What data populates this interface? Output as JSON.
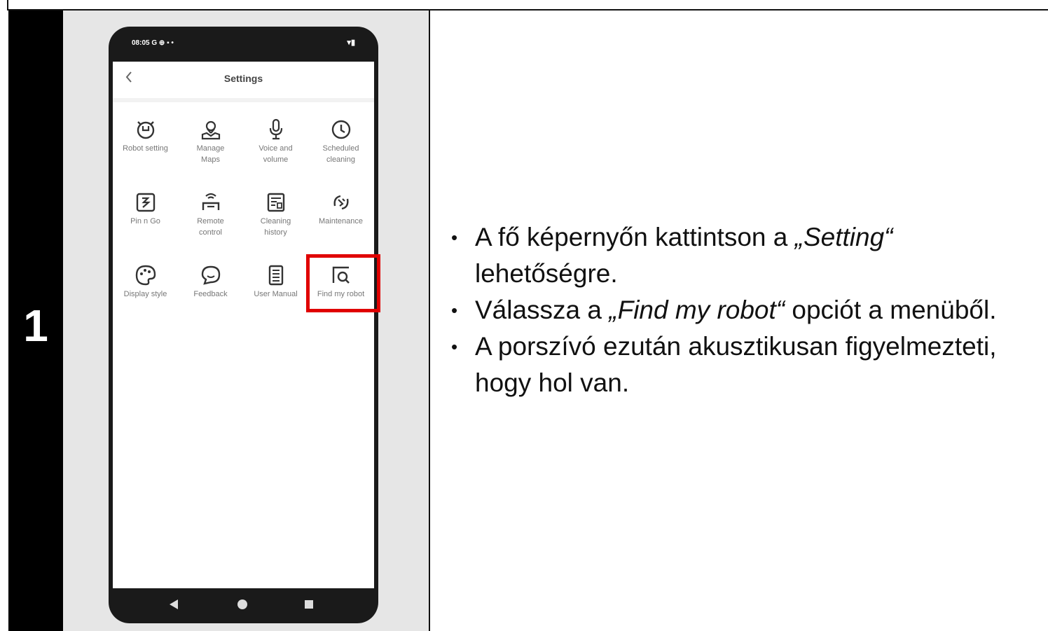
{
  "step": {
    "number": "1"
  },
  "phone": {
    "status_time": "08:05",
    "status_icons_left": "G ⊕ ▪ •",
    "status_icons_right": "▾▮",
    "screen_title": "Settings",
    "settings_items": [
      {
        "label_line1": "Robot setting",
        "label_line2": "",
        "icon": "robot-icon"
      },
      {
        "label_line1": "Manage",
        "label_line2": "Maps",
        "icon": "map-icon"
      },
      {
        "label_line1": "Voice and",
        "label_line2": "volume",
        "icon": "microphone-icon"
      },
      {
        "label_line1": "Scheduled",
        "label_line2": "cleaning",
        "icon": "clock-icon"
      },
      {
        "label_line1": "Pin n Go",
        "label_line2": "",
        "icon": "pin-n-go-icon"
      },
      {
        "label_line1": "Remote",
        "label_line2": "control",
        "icon": "remote-control-icon"
      },
      {
        "label_line1": "Cleaning",
        "label_line2": "history",
        "icon": "history-icon"
      },
      {
        "label_line1": "Maintenance",
        "label_line2": "",
        "icon": "maintenance-icon"
      },
      {
        "label_line1": "Display style",
        "label_line2": "",
        "icon": "palette-icon"
      },
      {
        "label_line1": "Feedback",
        "label_line2": "",
        "icon": "feedback-icon"
      },
      {
        "label_line1": "User Manual",
        "label_line2": "",
        "icon": "manual-icon"
      },
      {
        "label_line1": "Find my robot",
        "label_line2": "",
        "icon": "find-robot-icon"
      }
    ],
    "highlight_color": "#e00000"
  },
  "instructions": [
    {
      "pre": "A fő képernyőn kattintson a ",
      "em": "„Setting“",
      "post": " lehetőségre."
    },
    {
      "pre": "Válassza a ",
      "em": "„Find my robot“",
      "post": " opciót a menüből."
    },
    {
      "pre": "A porszívó ezután akusztikusan figyelmezteti, hogy hol van.",
      "em": "",
      "post": ""
    }
  ]
}
